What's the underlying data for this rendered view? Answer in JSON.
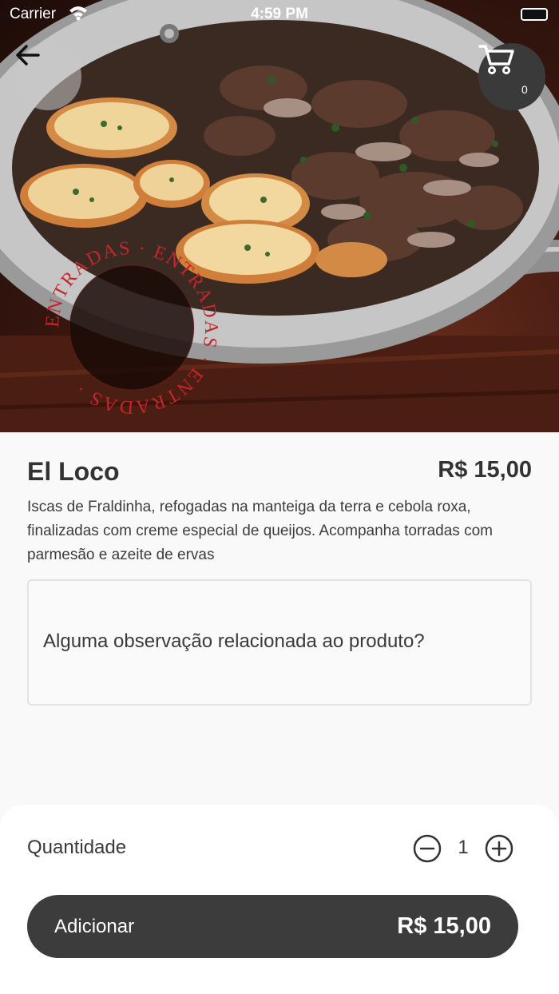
{
  "status_bar": {
    "carrier": "Carrier",
    "time": "4:59 PM"
  },
  "header": {
    "back_icon": "arrow-left-icon",
    "cart_icon": "cart-icon",
    "cart_count": "0"
  },
  "hero": {
    "stamp_text": "ENTRADAS · ENTRADAS · ENTRADAS ·",
    "stamp_color": "#c3262c"
  },
  "product": {
    "name": "El Loco",
    "price": "R$ 15,00",
    "description": "Iscas de Fraldinha, refogadas na manteiga da terra e cebola roxa, finalizadas com creme especial de queijos. Acompanha torradas com parmesão e azeite de ervas",
    "notes_placeholder": "Alguma observação relacionada ao produto?"
  },
  "order": {
    "quantity_label": "Quantidade",
    "quantity": "1",
    "minus_icon": "minus-circle-icon",
    "plus_icon": "plus-circle-icon",
    "add_label": "Adicionar",
    "total": "R$ 15,00"
  },
  "colors": {
    "button_dark": "#3c3c3c",
    "background": "#f9f9f9"
  }
}
